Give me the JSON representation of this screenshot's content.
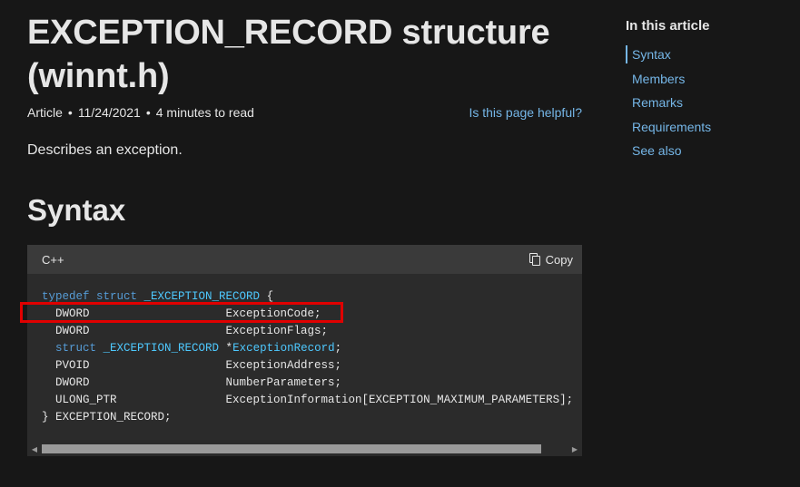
{
  "article": {
    "title": "EXCEPTION_RECORD structure\n(winnt.h)",
    "meta": {
      "type": "Article",
      "date": "11/24/2021",
      "read_time": "4 minutes to read",
      "helpful_link": "Is this page helpful?"
    },
    "description": "Describes an exception.",
    "syntax_heading": "Syntax"
  },
  "code_block": {
    "language": "C++",
    "copy_label": "Copy",
    "lines": [
      [
        "typedef struct ",
        "_EXCEPTION_RECORD",
        " {"
      ],
      [
        "  DWORD                    ExceptionCode;"
      ],
      [
        "  DWORD                    ExceptionFlags;"
      ],
      [
        "  struct ",
        "_EXCEPTION_RECORD",
        " *",
        "ExceptionRecord",
        ";"
      ],
      [
        "  PVOID                    ExceptionAddress;"
      ],
      [
        "  DWORD                    NumberParameters;"
      ],
      [
        "  ULONG_PTR                ExceptionInformation[EXCEPTION_MAXIMUM_PARAMETERS];"
      ],
      [
        "} EXCEPTION_RECORD;"
      ]
    ],
    "highlight_color": "#e00000"
  },
  "toc": {
    "title": "In this article",
    "items": [
      {
        "label": "Syntax",
        "active": true
      },
      {
        "label": "Members",
        "active": false
      },
      {
        "label": "Remarks",
        "active": false
      },
      {
        "label": "Requirements",
        "active": false
      },
      {
        "label": "See also",
        "active": false
      }
    ]
  },
  "colors": {
    "background": "#171717",
    "link": "#75b6e7",
    "code_bg": "#2b2b2b",
    "code_header_bg": "#3a3a3a",
    "keyword": "#569cd6",
    "type": "#4ec9ff"
  }
}
